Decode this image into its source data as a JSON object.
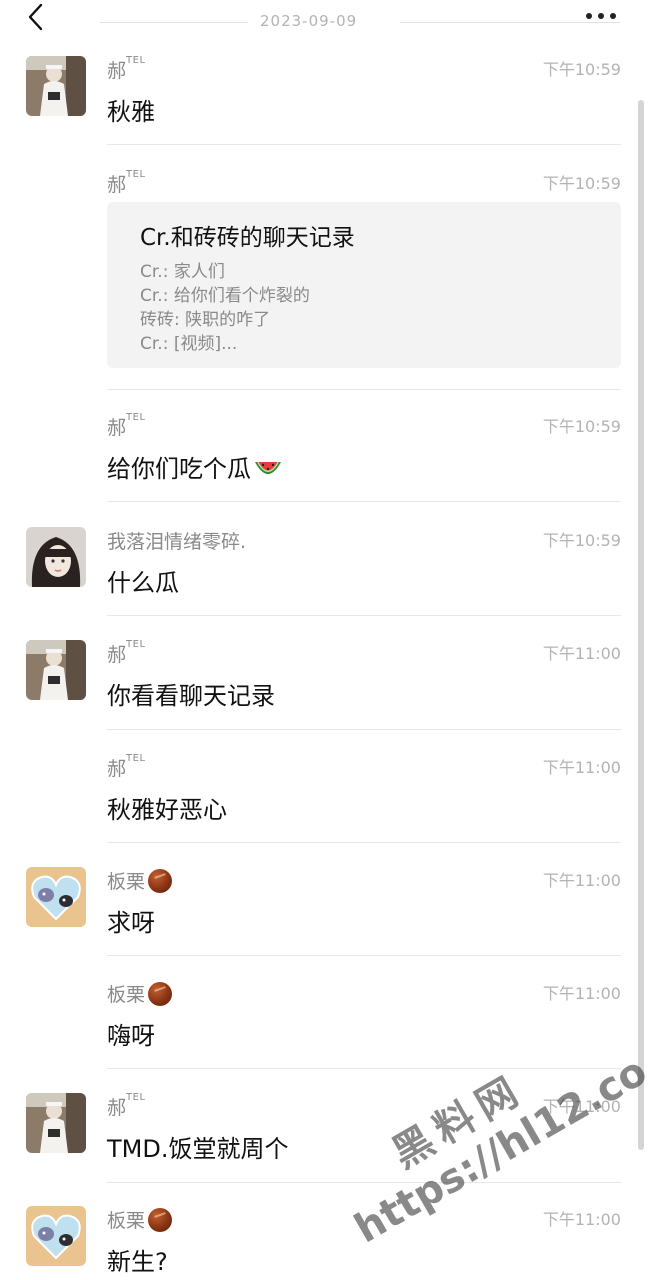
{
  "header": {
    "date": "2023-09-09"
  },
  "messages": [
    {
      "sender": "郝",
      "sender_sup": "TEL",
      "time": "下午10:59",
      "text": "秋雅",
      "avatar": "avatar-girl-mirror"
    },
    {
      "sender": "郝",
      "sender_sup": "TEL",
      "time": "下午10:59",
      "record": {
        "title": "Cr.和砖砖的聊天记录",
        "lines": [
          "Cr.: 家人们",
          "Cr.: 给你们看个炸裂的",
          "砖砖: 陕职的咋了",
          "Cr.: [视频]..."
        ]
      }
    },
    {
      "sender": "郝",
      "sender_sup": "TEL",
      "time": "下午10:59",
      "text": "给你们吃个瓜"
    },
    {
      "sender": "我落泪情绪零碎.",
      "time": "下午10:59",
      "text": "什么瓜",
      "avatar": "avatar-girl-selfie"
    },
    {
      "sender": "郝",
      "sender_sup": "TEL",
      "time": "下午11:00",
      "text": "你看看聊天记录",
      "avatar": "avatar-girl-mirror"
    },
    {
      "sender": "郝",
      "sender_sup": "TEL",
      "time": "下午11:00",
      "text": "秋雅好恶心"
    },
    {
      "sender": "板栗",
      "time": "下午11:00",
      "text": "求呀",
      "avatar": "avatar-cartoon-heart"
    },
    {
      "sender": "板栗",
      "time": "下午11:00",
      "text": "嗨呀"
    },
    {
      "sender": "郝",
      "sender_sup": "TEL",
      "time": "下午11:00",
      "text": "TMD.饭堂就周个",
      "avatar": "avatar-girl-mirror"
    },
    {
      "sender": "板栗",
      "time": "下午11:00",
      "text": "新生?",
      "avatar": "avatar-cartoon-heart"
    }
  ],
  "watermark": {
    "line1": "黑料网",
    "line2": "https://hl12.co"
  },
  "icons": {
    "back": "chevron-left-icon",
    "more": "more-dots-icon",
    "watermelon": "watermelon-emoji-icon",
    "chestnut": "chestnut-emoji-icon"
  }
}
